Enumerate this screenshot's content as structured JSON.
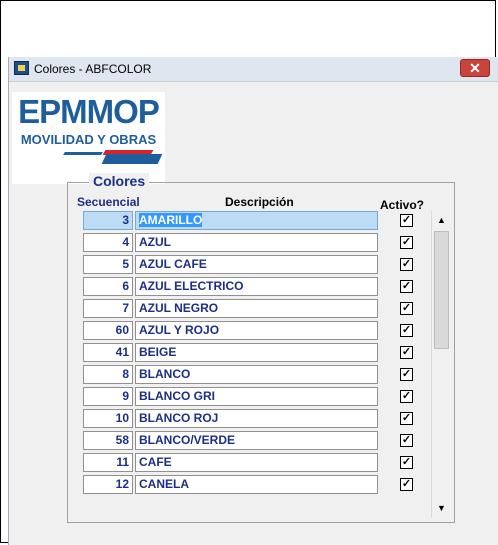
{
  "window": {
    "title": "Colores - ABFCOLOR",
    "close_label": "✕"
  },
  "logo": {
    "main": "EPMMOP",
    "sub": "MOVILIDAD Y OBRAS"
  },
  "group": {
    "title": "Colores",
    "headers": {
      "secuencial": "Secuencial",
      "descripcion": "Descripción",
      "activo": "Activo?"
    }
  },
  "rows": [
    {
      "seq": "3",
      "desc": "AMARILLO",
      "active": true,
      "selected": true
    },
    {
      "seq": "4",
      "desc": "AZUL",
      "active": true
    },
    {
      "seq": "5",
      "desc": "AZUL CAFE",
      "active": true
    },
    {
      "seq": "6",
      "desc": "AZUL ELECTRICO",
      "active": true
    },
    {
      "seq": "7",
      "desc": "AZUL NEGRO",
      "active": true
    },
    {
      "seq": "60",
      "desc": "AZUL Y ROJO",
      "active": true
    },
    {
      "seq": "41",
      "desc": "BEIGE",
      "active": true
    },
    {
      "seq": "8",
      "desc": "BLANCO",
      "active": true
    },
    {
      "seq": "9",
      "desc": "BLANCO GRI",
      "active": true
    },
    {
      "seq": "10",
      "desc": "BLANCO ROJ",
      "active": true
    },
    {
      "seq": "58",
      "desc": "BLANCO/VERDE",
      "active": true
    },
    {
      "seq": "11",
      "desc": "CAFE",
      "active": true
    },
    {
      "seq": "12",
      "desc": "CANELA",
      "active": true
    }
  ],
  "scrollbar": {
    "up_icon": "chevron-up-icon",
    "down_icon": "chevron-down-icon"
  },
  "colors": {
    "label_blue": "#1c2f86",
    "selection": "#3399ff",
    "close_red": "#c8443c"
  }
}
